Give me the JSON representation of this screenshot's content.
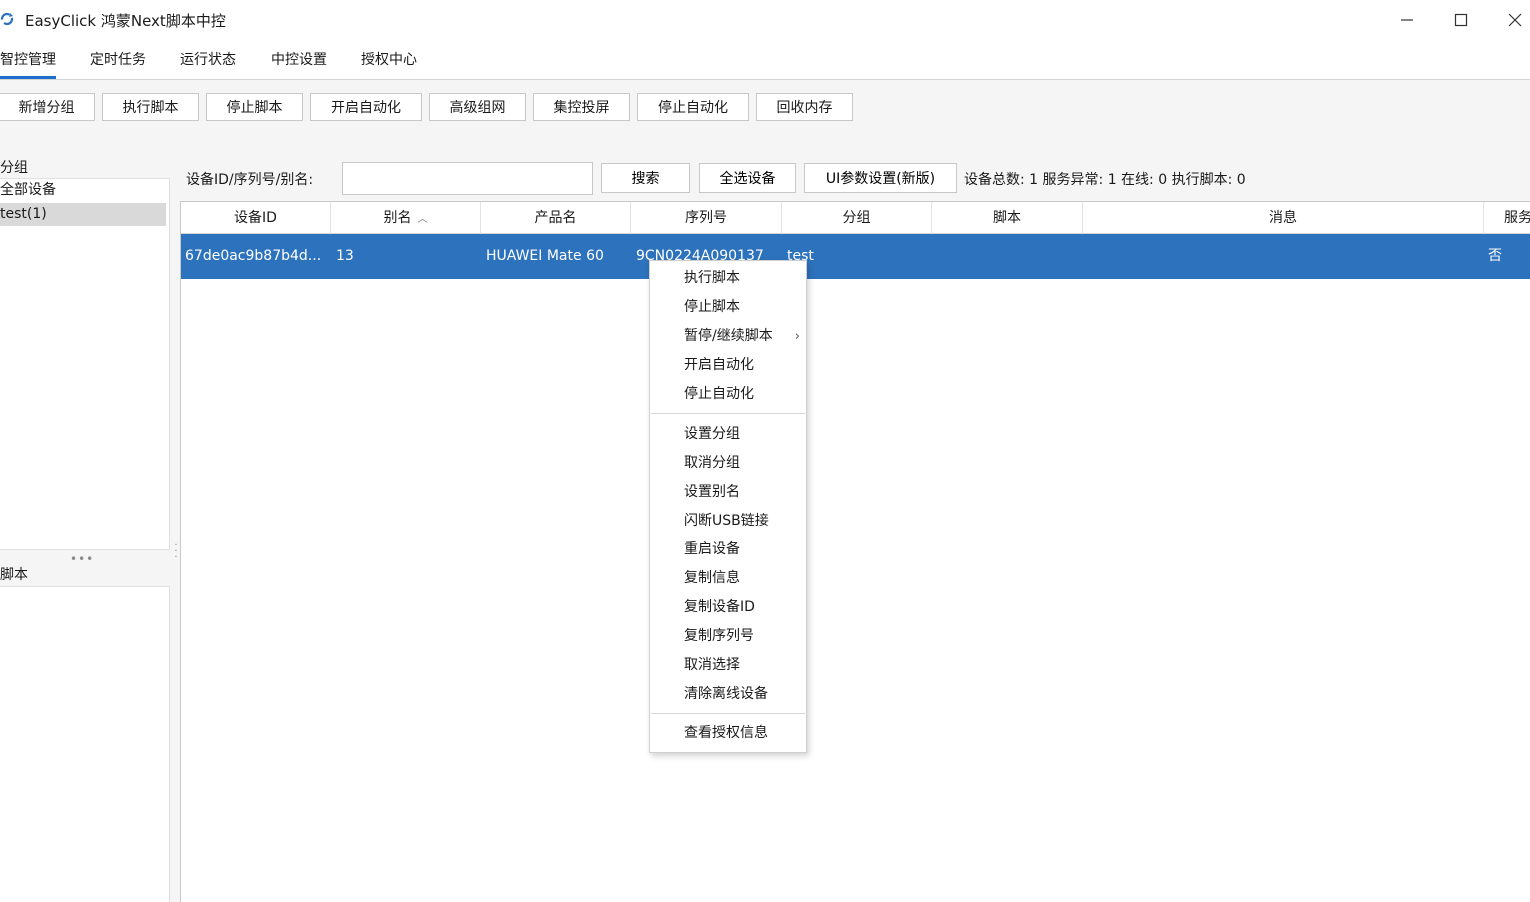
{
  "window": {
    "title": "EasyClick 鸿蒙Next脚本中控",
    "icon": "refresh-app-icon"
  },
  "menu": {
    "tabs": [
      "智控管理",
      "定时任务",
      "运行状态",
      "中控设置",
      "授权中心"
    ],
    "active_index": 0
  },
  "toolbar": {
    "buttons": [
      "新增分组",
      "执行脚本",
      "停止脚本",
      "开启自动化",
      "高级组网",
      "集控投屏",
      "停止自动化",
      "回收内存"
    ]
  },
  "left": {
    "group_title": "分组",
    "groups": [
      "全部设备",
      "test(1)"
    ],
    "selected_group_index": 1,
    "script_title": "脚本"
  },
  "search": {
    "label": "设备ID/序列号/别名:",
    "value": "",
    "search_button": "搜索",
    "select_all_button": "全选设备",
    "ui_params_button": "UI参数设置(新版)"
  },
  "stats": "设备总数: 1 服务异常: 1  在线: 0 执行脚本: 0",
  "table": {
    "columns": [
      "设备ID",
      "别名",
      "产品名",
      "序列号",
      "分组",
      "脚本",
      "消息",
      "服务"
    ],
    "sorted_column": "别名",
    "rows": [
      {
        "device_id": "67de0ac9b87b4d...",
        "alias": "13",
        "product": "HUAWEI Mate 60",
        "serial": "9CN0224A090137",
        "group": "test",
        "script": "",
        "message": "",
        "service": "否"
      }
    ]
  },
  "context_menu": {
    "sections": [
      [
        {
          "label": "执行脚本"
        },
        {
          "label": "停止脚本"
        },
        {
          "label": "暂停/继续脚本",
          "has_submenu": true
        },
        {
          "label": "开启自动化"
        },
        {
          "label": "停止自动化"
        }
      ],
      [
        {
          "label": "设置分组"
        },
        {
          "label": "取消分组"
        },
        {
          "label": "设置别名"
        },
        {
          "label": "闪断USB链接"
        },
        {
          "label": "重启设备"
        },
        {
          "label": "复制信息"
        },
        {
          "label": "复制设备ID"
        },
        {
          "label": "复制序列号"
        },
        {
          "label": "取消选择"
        },
        {
          "label": "清除离线设备"
        }
      ],
      [
        {
          "label": "查看授权信息"
        }
      ]
    ]
  },
  "colors": {
    "accent": "#1e6fc9",
    "row_selected": "#2d72bd"
  }
}
